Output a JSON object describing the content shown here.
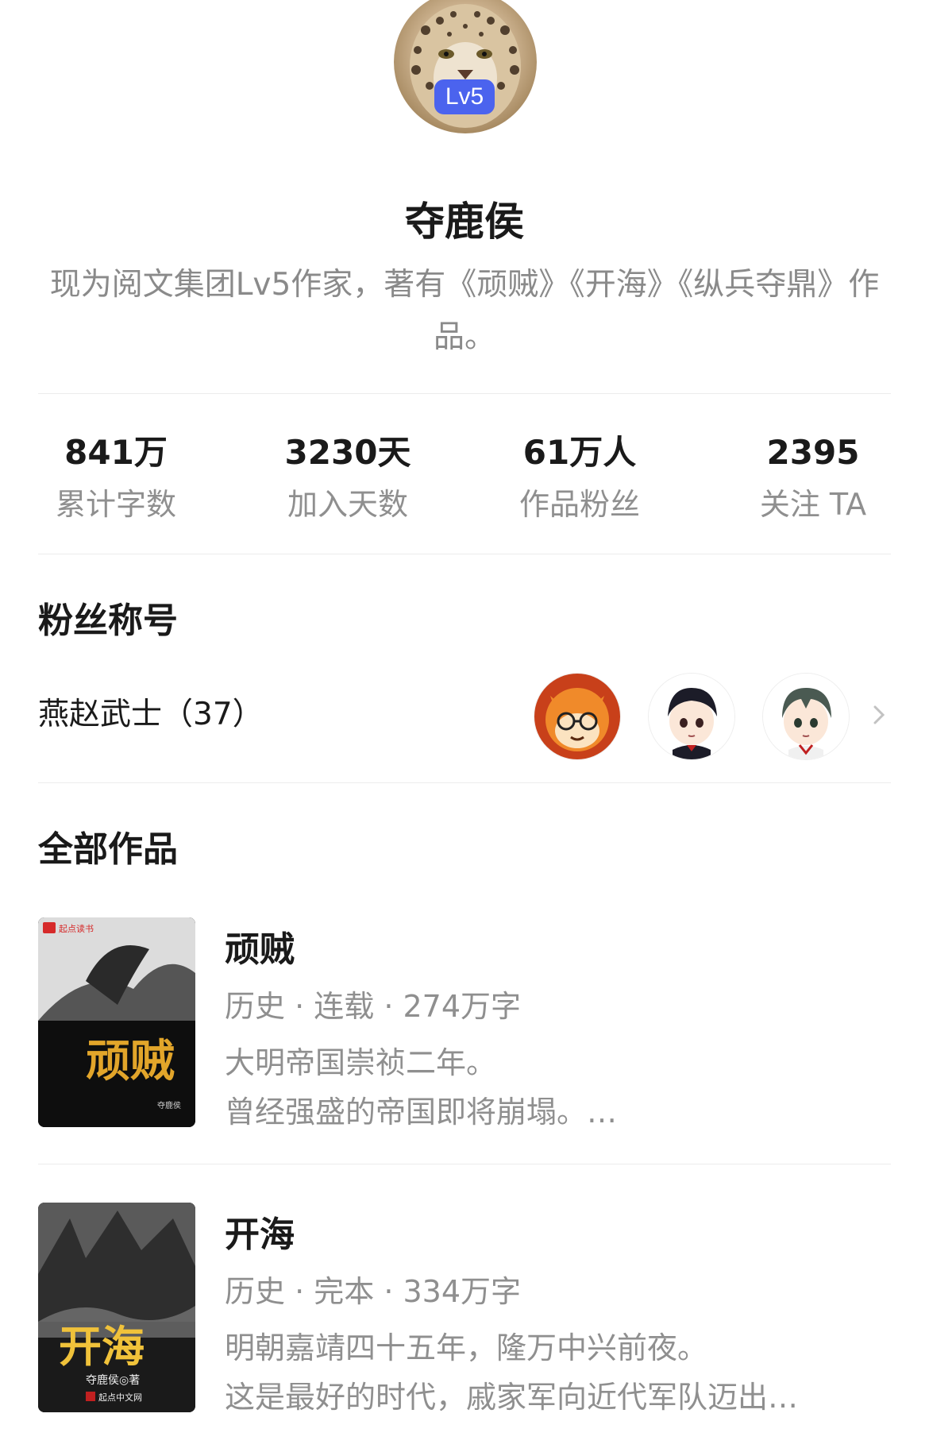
{
  "profile": {
    "avatar_icon": "leopard-avatar",
    "level": "Lv5",
    "name": "夺鹿侯",
    "bio": "现为阅文集团Lv5作家，著有《顽贼》《开海》《纵兵夺鼎》作品。"
  },
  "stats": [
    {
      "value": "841万",
      "label": "累计字数"
    },
    {
      "value": "3230天",
      "label": "加入天数"
    },
    {
      "value": "61万人",
      "label": "作品粉丝"
    },
    {
      "value": "2395",
      "label": "关注 TA"
    }
  ],
  "fan_section": {
    "title": "粉丝称号",
    "fan_title": "燕赵武士（37）",
    "avatars": [
      "fox-avatar",
      "anime-boy-avatar",
      "anime-boy-avatar-2"
    ],
    "chevron_icon": "chevron-right-icon"
  },
  "works_section": {
    "title": "全部作品",
    "works": [
      {
        "title": "顽贼",
        "meta": "历史 · 连载 · 274万字",
        "desc_line1": "大明帝国崇祯二年。",
        "desc_line2": "曾经强盛的帝国即将崩塌。…",
        "cover_badge": "起点读书",
        "cover_title": "顽贼",
        "cover_author": "夺鹿侯"
      },
      {
        "title": "开海",
        "meta": "历史 · 完本 · 334万字",
        "desc_line1": "明朝嘉靖四十五年，隆万中兴前夜。",
        "desc_line2": "这是最好的时代，戚家军向近代军队迈出…",
        "cover_title": "开海",
        "cover_author": "夺鹿侯◎著",
        "cover_publisher": "起点中文网"
      }
    ]
  },
  "colors": {
    "level_badge": "#4b63ee",
    "primary_text": "#1a1a1a",
    "secondary_text": "#8f8f8f",
    "divider": "#ececec"
  }
}
